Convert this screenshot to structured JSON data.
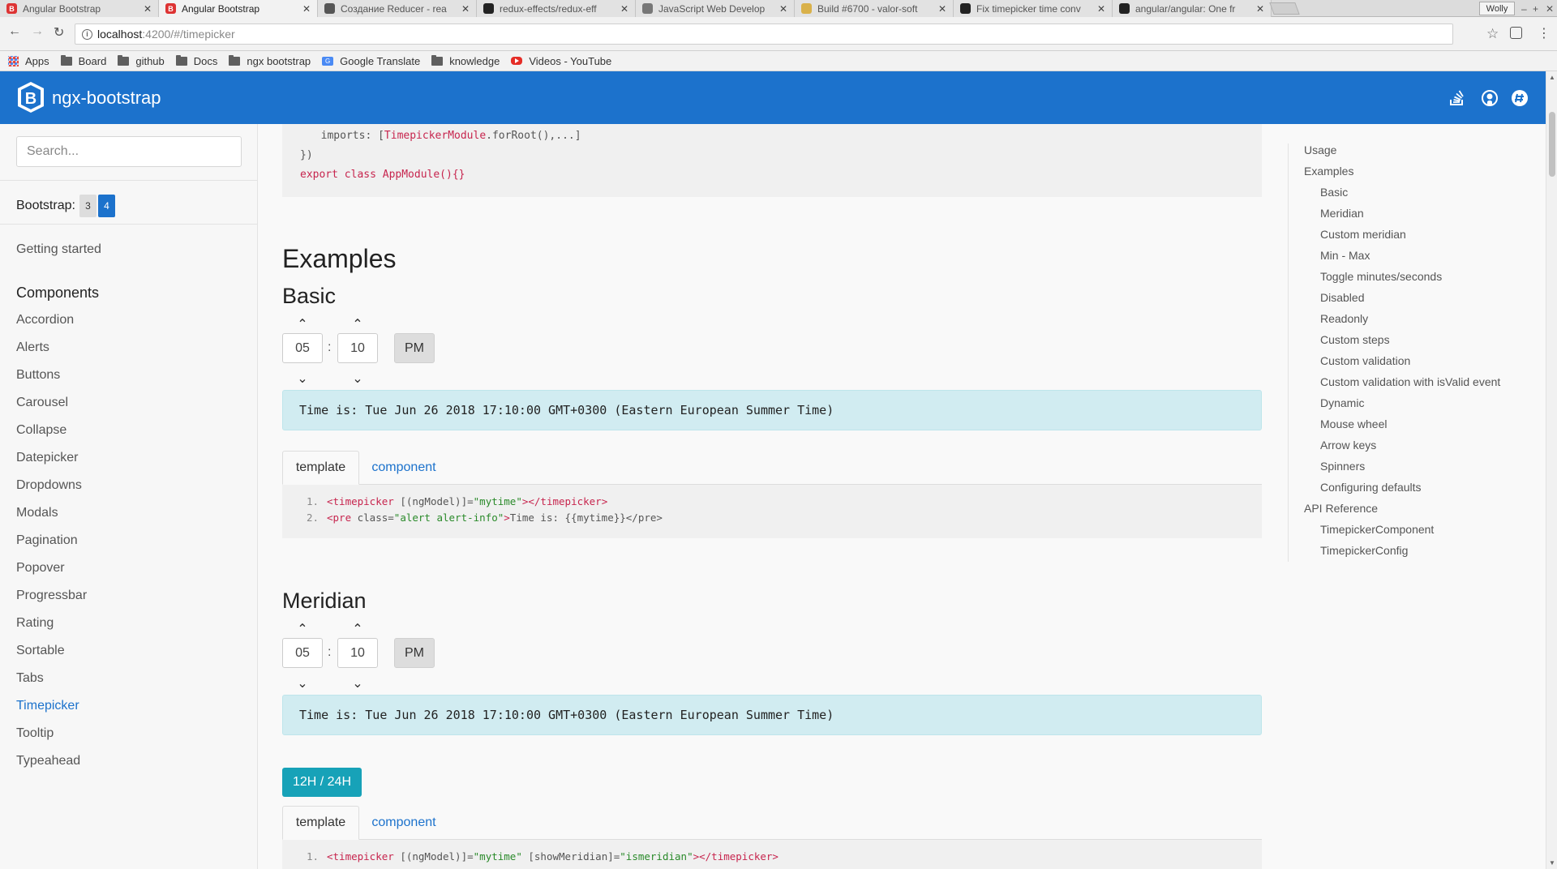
{
  "browser": {
    "tabs": [
      {
        "title": "Angular Bootstrap",
        "favicon_color": "#d33",
        "favicon_letter": "B",
        "active": false
      },
      {
        "title": "Angular Bootstrap",
        "favicon_color": "#d33",
        "favicon_letter": "B",
        "active": true
      },
      {
        "title": "Создание Reducer - rea",
        "favicon_color": "#555",
        "favicon_letter": "",
        "active": false
      },
      {
        "title": "redux-effects/redux-eff",
        "favicon_color": "#222",
        "favicon_letter": "",
        "active": false
      },
      {
        "title": "JavaScript Web Develop",
        "favicon_color": "#777",
        "favicon_letter": "",
        "active": false
      },
      {
        "title": "Build #6700 - valor-soft",
        "favicon_color": "#d9b14a",
        "favicon_letter": "",
        "active": false
      },
      {
        "title": "Fix timepicker time conv",
        "favicon_color": "#222",
        "favicon_letter": "",
        "active": false
      },
      {
        "title": "angular/angular: One fr",
        "favicon_color": "#222",
        "favicon_letter": "",
        "active": false
      }
    ],
    "profile_label": "Wolly",
    "url_host": "localhost",
    "url_path": ":4200/#/timepicker",
    "bookmarks": [
      {
        "label": "Apps",
        "icon": "apps-icon"
      },
      {
        "label": "Board",
        "icon": "folder-icon"
      },
      {
        "label": "github",
        "icon": "folder-icon"
      },
      {
        "label": "Docs",
        "icon": "folder-icon"
      },
      {
        "label": "ngx bootstrap",
        "icon": "folder-icon"
      },
      {
        "label": "Google Translate",
        "icon": "google-translate-icon"
      },
      {
        "label": "knowledge",
        "icon": "folder-icon"
      },
      {
        "label": "Videos - YouTube",
        "icon": "youtube-icon"
      }
    ]
  },
  "header": {
    "brand": "ngx-bootstrap",
    "accent_color": "#1c72cc"
  },
  "sidebar": {
    "search_placeholder": "Search...",
    "bootstrap_label": "Bootstrap:",
    "bootstrap_versions": [
      "3",
      "4"
    ],
    "getting_started": "Getting started",
    "components_heading": "Components",
    "items": [
      "Accordion",
      "Alerts",
      "Buttons",
      "Carousel",
      "Collapse",
      "Datepicker",
      "Dropdowns",
      "Modals",
      "Pagination",
      "Popover",
      "Progressbar",
      "Rating",
      "Sortable",
      "Tabs",
      "Timepicker",
      "Tooltip",
      "Typeahead"
    ],
    "active_item": "Timepicker"
  },
  "main": {
    "top_code": {
      "line1_pre": "  imports: [",
      "line1_kw": "TimepickerModule",
      "line1_post": ".forRoot(),...]",
      "line2": "})",
      "line3": "export class AppModule(){}"
    },
    "examples_heading": "Examples",
    "basic": {
      "heading": "Basic",
      "hours": "05",
      "minutes": "10",
      "meridian": "PM",
      "colon": ":",
      "alert": "Time is: Tue Jun 26 2018 17:10:00 GMT+0300 (Eastern European Summer Time)",
      "tab_template": "template",
      "tab_component": "component",
      "code": [
        {
          "num": "1.",
          "open": "<timepicker",
          "attr": " [(ngModel)]=",
          "str": "\"mytime\"",
          "close": "></timepicker>",
          "text": ""
        },
        {
          "num": "2.",
          "open": "<pre",
          "attr": " class=",
          "str": "\"alert alert-info\"",
          "close": ">",
          "text": "Time is: {{mytime}}</pre>"
        }
      ]
    },
    "meridian": {
      "heading": "Meridian",
      "hours": "05",
      "minutes": "10",
      "meridian": "PM",
      "colon": ":",
      "alert": "Time is: Tue Jun 26 2018 17:10:00 GMT+0300 (Eastern European Summer Time)",
      "toggle_label": "12H / 24H",
      "tab_template": "template",
      "tab_component": "component",
      "code": [
        {
          "num": "1.",
          "open": "<timepicker",
          "attr": " [(ngModel)]=",
          "str": "\"mytime\"",
          "attr2": " [showMeridian]=",
          "str2": "\"ismeridian\"",
          "close": "></timepicker>"
        }
      ]
    }
  },
  "toc": {
    "items": [
      {
        "label": "Usage",
        "level": 1
      },
      {
        "label": "Examples",
        "level": 1
      },
      {
        "label": "Basic",
        "level": 2
      },
      {
        "label": "Meridian",
        "level": 2
      },
      {
        "label": "Custom meridian",
        "level": 2
      },
      {
        "label": "Min - Max",
        "level": 2
      },
      {
        "label": "Toggle minutes/seconds",
        "level": 2
      },
      {
        "label": "Disabled",
        "level": 2
      },
      {
        "label": "Readonly",
        "level": 2
      },
      {
        "label": "Custom steps",
        "level": 2
      },
      {
        "label": "Custom validation",
        "level": 2
      },
      {
        "label": "Custom validation with isValid event",
        "level": 2
      },
      {
        "label": "Dynamic",
        "level": 2
      },
      {
        "label": "Mouse wheel",
        "level": 2
      },
      {
        "label": "Arrow keys",
        "level": 2
      },
      {
        "label": "Spinners",
        "level": 2
      },
      {
        "label": "Configuring defaults",
        "level": 2
      },
      {
        "label": "API Reference",
        "level": 1
      },
      {
        "label": "TimepickerComponent",
        "level": 2
      },
      {
        "label": "TimepickerConfig",
        "level": 2
      }
    ]
  }
}
